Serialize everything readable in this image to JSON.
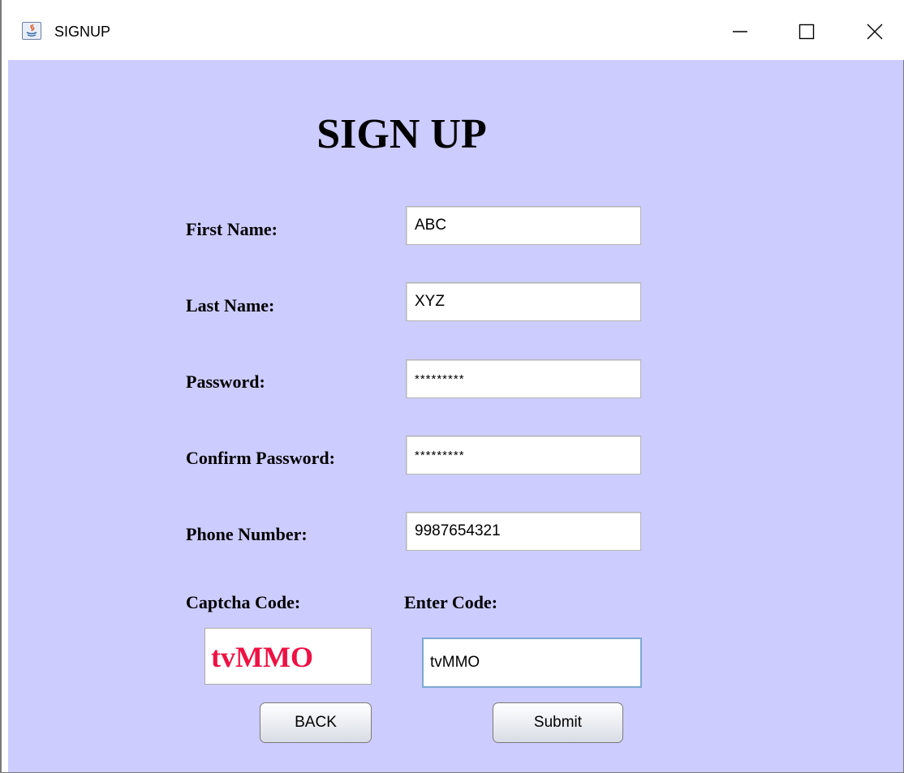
{
  "window": {
    "title": "SIGNUP",
    "app_icon": "java-icon",
    "controls": {
      "minimize": "minimize-icon",
      "maximize": "maximize-icon",
      "close": "close-icon"
    }
  },
  "form": {
    "heading": "SIGN UP",
    "first_name": {
      "label": "First Name:",
      "value": "ABC"
    },
    "last_name": {
      "label": "Last Name:",
      "value": "XYZ"
    },
    "password": {
      "label": "Password:",
      "value": "*********"
    },
    "confirm_password": {
      "label": "Confirm Password:",
      "value": "*********"
    },
    "phone_number": {
      "label": "Phone Number:",
      "value": "9987654321"
    },
    "captcha": {
      "label": "Captcha Code:",
      "code": "tvMMO",
      "code_color": "#ee1144"
    },
    "enter_code": {
      "label": "Enter Code:",
      "value": "tvMMO"
    },
    "buttons": {
      "back": "BACK",
      "submit": "Submit"
    }
  },
  "colors": {
    "background": "#ccccff",
    "titlebar": "#ffffff"
  }
}
